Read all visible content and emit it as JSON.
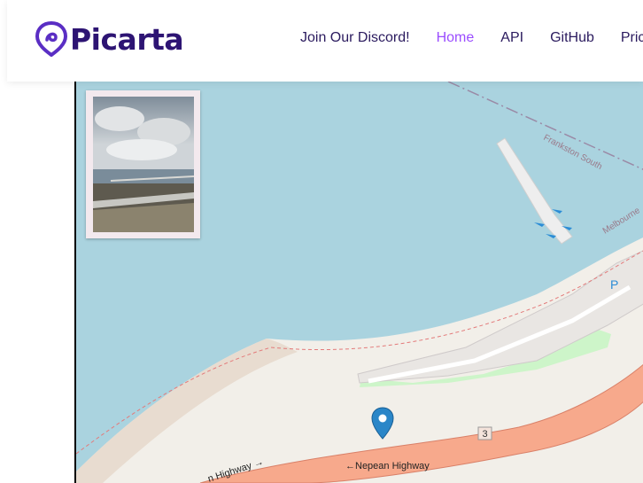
{
  "brand": {
    "name": "Picarta",
    "color": "#2d1473"
  },
  "nav": {
    "items": [
      {
        "label": "Join Our Discord!",
        "active": false
      },
      {
        "label": "Home",
        "active": true
      },
      {
        "label": "API",
        "active": false
      },
      {
        "label": "GitHub",
        "active": false
      },
      {
        "label": "Pric",
        "active": false
      }
    ],
    "active_color": "#9b4dff"
  },
  "map": {
    "labels": {
      "frankston_south": "Frankston South",
      "melbourne": "Melbourne",
      "nepean_highway": "←Nepean Highway",
      "highway_left": "n Highway →",
      "route_number": "3",
      "parking": "P"
    },
    "colors": {
      "water": "#aad3df",
      "land": "#f2efe9",
      "road": "#f7a98c",
      "park": "#cdf5c9"
    },
    "marker_icon": "map-pin-icon"
  },
  "photo": {
    "subject": "coastal road with cloudy sky"
  }
}
